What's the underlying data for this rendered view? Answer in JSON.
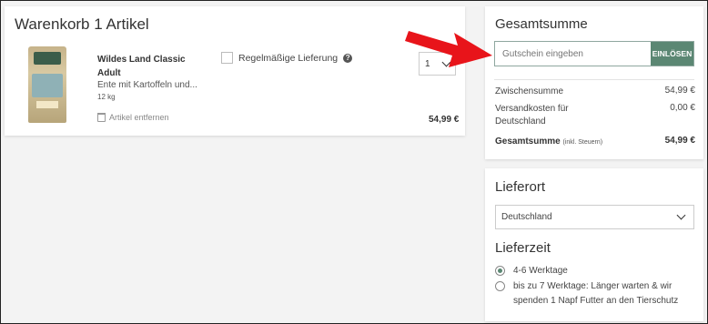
{
  "cart": {
    "title": "Warenkorb 1 Artikel",
    "product": {
      "name": "Wildes Land Classic Adult",
      "description": "Ente mit Kartoffeln und...",
      "weight": "12 kg",
      "remove_label": "Artikel entfernen",
      "subscribe_label": "Regelmäßige Lieferung",
      "help_icon": "?",
      "quantity": "1",
      "price": "54,99 €"
    }
  },
  "summary": {
    "title": "Gesamtsumme",
    "coupon_placeholder": "Gutschein eingeben",
    "coupon_button": "EINLÖSEN",
    "subtotal_label": "Zwischensumme",
    "subtotal_value": "54,99 €",
    "shipping_label": "Versandkosten für Deutschland",
    "shipping_value": "0,00 €",
    "total_label": "Gesamtsumme",
    "total_note": "(inkl. Steuern)",
    "total_value": "54,99 €"
  },
  "delivery": {
    "location_title": "Lieferort",
    "country": "Deutschland",
    "time_title": "Lieferzeit",
    "options": [
      {
        "label": "4-6 Werktage",
        "checked": true
      },
      {
        "label": "bis zu 7 Werktage: Länger warten & wir spenden 1 Napf Futter an den Tierschutz",
        "checked": false
      }
    ]
  },
  "colors": {
    "accent": "#5b8773",
    "annotation_arrow": "#e8141a"
  }
}
